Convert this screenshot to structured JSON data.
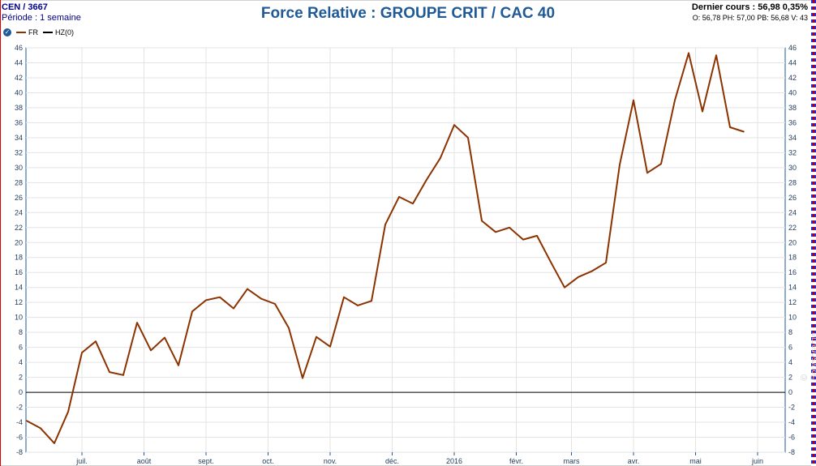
{
  "header": {
    "symbol": "CEN / 3667",
    "period": "Période : 1 semaine",
    "title": "Force Relative : GROUPE CRIT / CAC 40",
    "last_price": "Dernier cours :  56,98   0,35%",
    "ohlc": "O: 56,78  PH: 57,00  PB: 56,68  V: 43"
  },
  "legend": {
    "items": [
      {
        "label": "FR",
        "color": "#8b3300"
      },
      {
        "label": "HZ(0)",
        "color": "#000000"
      }
    ]
  },
  "watermark": "© Boursorama",
  "colors": {
    "title": "#1f5a96",
    "series": "#8b3300",
    "zero_line": "#000000",
    "grid": "#e3e3e3",
    "axis": "#1f5a96"
  },
  "chart_data": {
    "type": "line",
    "title": "Force Relative : GROUPE CRIT / CAC 40",
    "xlabel": "",
    "ylabel": "",
    "ylim": [
      -8,
      46
    ],
    "yticks": [
      -8,
      -6,
      -4,
      -2,
      0,
      2,
      4,
      6,
      8,
      10,
      12,
      14,
      16,
      18,
      20,
      22,
      24,
      26,
      28,
      30,
      32,
      34,
      36,
      38,
      40,
      42,
      44,
      46
    ],
    "x_month_labels": [
      {
        "label": "juil.",
        "week": 4
      },
      {
        "label": "août",
        "week": 8.5
      },
      {
        "label": "sept.",
        "week": 13
      },
      {
        "label": "oct.",
        "week": 17.5
      },
      {
        "label": "nov.",
        "week": 22
      },
      {
        "label": "déc.",
        "week": 26.5
      },
      {
        "label": "2016",
        "week": 31
      },
      {
        "label": "févr.",
        "week": 35.5
      },
      {
        "label": "mars",
        "week": 39.5
      },
      {
        "label": "avr.",
        "week": 44
      },
      {
        "label": "mai",
        "week": 48.5
      },
      {
        "label": "juin",
        "week": 53
      }
    ],
    "grid": true,
    "series": [
      {
        "name": "FR",
        "values": [
          -3.8,
          -4.8,
          -6.8,
          -2.6,
          5.3,
          6.8,
          2.7,
          2.3,
          9.3,
          5.6,
          7.3,
          3.6,
          10.8,
          12.3,
          12.7,
          11.2,
          13.8,
          12.5,
          11.8,
          8.6,
          1.9,
          7.4,
          6.1,
          12.7,
          11.6,
          12.2,
          22.4,
          26.1,
          25.2,
          28.4,
          31.3,
          35.7,
          34.0,
          22.9,
          21.4,
          22.0,
          20.4,
          20.9,
          17.4,
          14.0,
          15.4,
          16.2,
          17.3,
          30.4,
          39.0,
          29.3,
          30.5,
          39.0,
          45.3,
          37.5,
          45.0,
          35.4,
          34.8
        ]
      },
      {
        "name": "HZ(0)",
        "values": [
          0
        ]
      }
    ]
  }
}
